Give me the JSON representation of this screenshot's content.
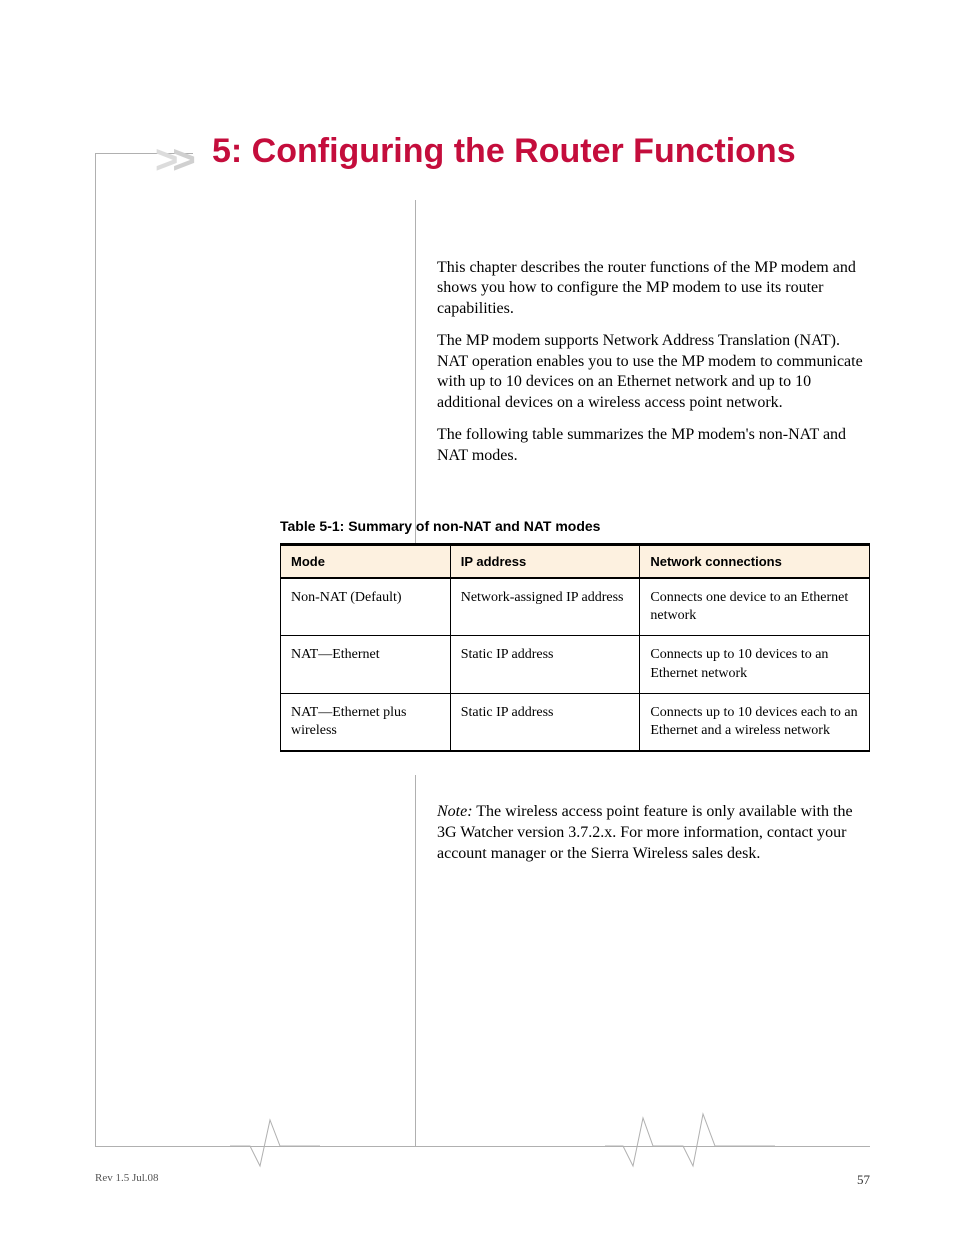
{
  "title": "5: Configuring the Router Functions",
  "paragraphs": {
    "p1": "This chapter describes the router functions of the MP modem and shows you how to configure the MP modem to use its router capabilities.",
    "p2": "The MP modem supports Network Address Translation (NAT). NAT operation enables you to use the MP modem to communicate with up to 10 devices on an Ethernet network and up to 10 additional devices on a wireless access point network.",
    "p3": "The following table summarizes the MP modem's non-NAT and NAT modes."
  },
  "table": {
    "caption": "Table 5-1: Summary of non-NAT and NAT modes",
    "headers": [
      "Mode",
      "IP address",
      "Network connections"
    ],
    "rows": [
      [
        "Non-NAT (Default)",
        "Network-assigned IP address",
        "Connects one device to an Ethernet network"
      ],
      [
        "NAT—Ethernet",
        "Static IP address",
        "Connects up to 10 devices to an Ethernet network"
      ],
      [
        "NAT—Ethernet plus wireless",
        "Static IP address",
        "Connects up to 10 devices each to an Ethernet and a wireless network"
      ]
    ]
  },
  "note_label": "Note:",
  "note_text": " The wireless access point feature is only available with the 3G Watcher version 3.7.2.x. For more information, contact your account manager or the Sierra Wireless sales desk.",
  "footer_left": "Rev 1.5  Jul.08",
  "footer_right": "57"
}
